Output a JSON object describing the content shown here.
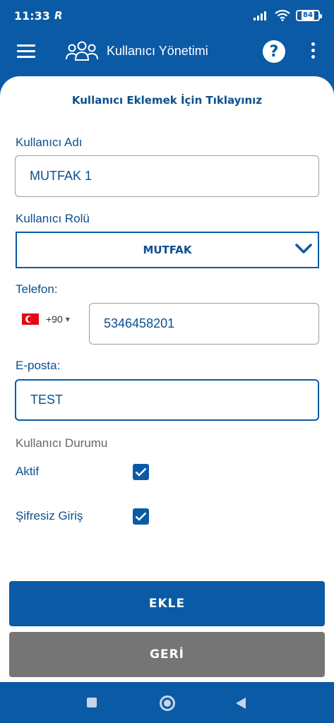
{
  "status_bar": {
    "time": "11:33",
    "brand": "R",
    "battery": "84"
  },
  "header": {
    "title": "Kullanıcı Yönetimi"
  },
  "form": {
    "add_prompt": "Kullanıcı Eklemek İçin Tıklayınız",
    "username_label": "Kullanıcı Adı",
    "username_value": "MUTFAK 1",
    "role_label": "Kullanıcı Rolü",
    "role_value": "MUTFAK",
    "phone_label": "Telefon:",
    "dial_code": "+90",
    "phone_value": "5346458201",
    "email_label": "E-posta:",
    "email_value": "TEST",
    "status_label": "Kullanıcı Durumu",
    "active_label": "Aktif",
    "active_checked": true,
    "passwordless_label": "Şifresiz Giriş",
    "passwordless_checked": true
  },
  "buttons": {
    "add": "EKLE",
    "back": "GERİ"
  },
  "colors": {
    "primary": "#0b5aa6",
    "text": "#0d4f8f",
    "secondary_button": "#757575"
  },
  "icons": [
    "menu-icon",
    "users-icon",
    "help-icon",
    "more-vert-icon",
    "chevron-down-icon",
    "turkey-flag-icon",
    "checkbox-checked-icon",
    "nav-square-icon",
    "nav-home-icon",
    "nav-back-icon"
  ]
}
